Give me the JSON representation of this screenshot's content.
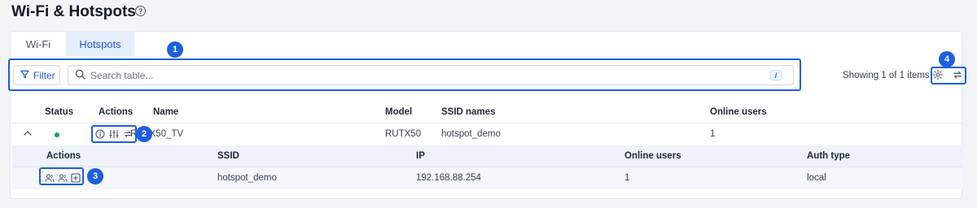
{
  "page": {
    "title": "Wi-Fi & Hotspots"
  },
  "tabs": [
    {
      "label": "Wi-Fi",
      "active": false
    },
    {
      "label": "Hotspots",
      "active": true
    }
  ],
  "toolbar": {
    "filter_label": "Filter",
    "search_placeholder": "Search table...",
    "search_shortcut": "/",
    "showing_text": "Showing 1 of 1 items"
  },
  "table": {
    "headers": [
      "Status",
      "Actions",
      "Name",
      "Model",
      "SSID names",
      "Online users"
    ],
    "rows": [
      {
        "status": "online",
        "name": "RUTX50_TV",
        "model": "RUTX50",
        "ssid_names": "hotspot_demo",
        "online_users": "1"
      }
    ]
  },
  "sub_table": {
    "headers": [
      "Actions",
      "SSID",
      "IP",
      "Online users",
      "Auth type"
    ],
    "rows": [
      {
        "ssid": "hotspot_demo",
        "ip": "192.168.88.254",
        "online_users": "1",
        "auth_type": "local"
      }
    ]
  },
  "annotations": [
    "1",
    "2",
    "3",
    "4"
  ],
  "colors": {
    "accent": "#1d5fe0",
    "status_online": "#16a34a",
    "active_tab_bg": "#e6eefb"
  }
}
